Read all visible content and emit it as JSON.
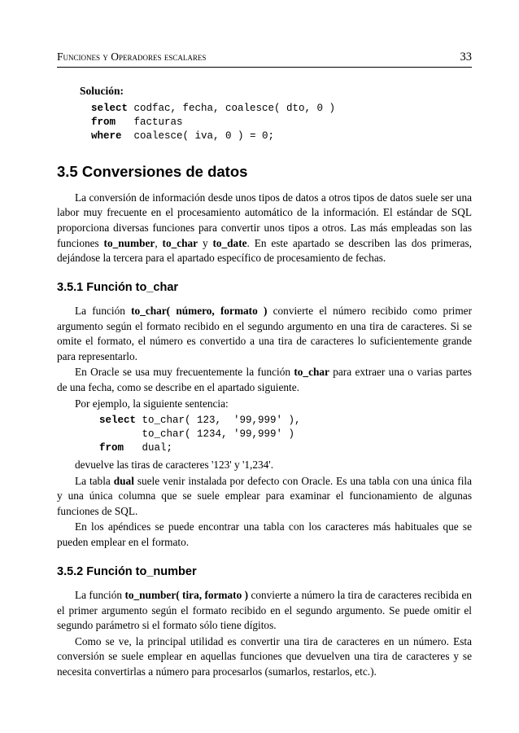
{
  "header": {
    "title": "Funciones y Operadores escalares",
    "page": "33"
  },
  "solucion": {
    "label": "Solución:",
    "code_line1a": "select ",
    "code_line1b": "codfac, fecha, coalesce( dto, 0 )",
    "code_line2a": "from   ",
    "code_line2b": "facturas",
    "code_line3a": "where  ",
    "code_line3b": "coalesce( iva, 0 ) = 0;"
  },
  "section_3_5": {
    "heading": "3.5 Conversiones de datos",
    "p1_a": "La conversión de información desde unos tipos de datos a otros tipos de datos suele ser una labor muy frecuente en el procesamiento automático de la información. El estándar de SQL proporciona diversas funciones para convertir unos tipos a otros. Las más empleadas son las funciones ",
    "p1_b1": "to_number",
    "p1_c": ", ",
    "p1_b2": "to_char",
    "p1_d": " y ",
    "p1_b3": "to_date",
    "p1_e": ". En este apartado se describen las dos primeras, dejándose la tercera para el apartado específico de procesamiento de fechas."
  },
  "section_3_5_1": {
    "heading": "3.5.1 Función to_char",
    "p1_a": "La función ",
    "p1_b": "to_char( número, formato )",
    "p1_c": " convierte el número recibido como primer argumento según el formato recibido en el segundo argumento en una tira de caracteres. Si se omite el formato, el número es convertido a una tira de caracteres lo suficientemente grande para representarlo.",
    "p2_a": "En Oracle se usa muy frecuentemente la función ",
    "p2_b": "to_char",
    "p2_c": " para extraer una o varias partes de una fecha, como se describe en el apartado siguiente.",
    "p3": "Por ejemplo, la siguiente sentencia:",
    "code_l1a": "select ",
    "code_l1b": "to_char( 123,  '99,999' ),",
    "code_l2": "       to_char( 1234, '99,999' )",
    "code_l3a": "from   ",
    "code_l3b": "dual;",
    "p4": "devuelve las tiras de caracteres  '123' y '1,234'.",
    "p5_a": "La tabla ",
    "p5_b": "dual",
    "p5_c": " suele venir instalada por defecto con Oracle. Es una tabla con una única fila y una única columna que se suele emplear para examinar el funcionamiento de algunas funciones de SQL.",
    "p6": "En los apéndices se puede encontrar una tabla con los caracteres más habituales que se pueden emplear en el formato."
  },
  "section_3_5_2": {
    "heading": "3.5.2 Función to_number",
    "p1_a": "La función ",
    "p1_b": "to_number( tira, formato )",
    "p1_c": " convierte a número la tira de caracteres recibida en el primer argumento según el formato recibido en el segundo argumento. Se puede omitir el segundo parámetro si el formato sólo tiene dígitos.",
    "p2": "Como se ve, la principal utilidad es convertir una tira de caracteres en un número. Esta conversión se suele emplear en aquellas funciones que devuelven una tira de caracteres y se necesita convertirlas a número para procesarlos (sumarlos, restarlos, etc.)."
  }
}
